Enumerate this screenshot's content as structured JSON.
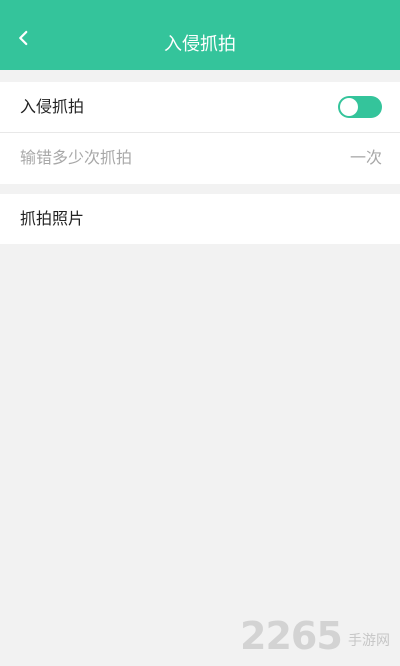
{
  "header": {
    "title": "入侵抓拍",
    "back_icon": "chevron-left-icon"
  },
  "settings": {
    "intrusion_capture": {
      "label": "入侵抓拍",
      "enabled": false
    },
    "attempts": {
      "label": "输错多少次抓拍",
      "value": "一次"
    },
    "photos": {
      "label": "抓拍照片"
    }
  },
  "watermark": {
    "number": "2265",
    "text": "手游网"
  },
  "colors": {
    "accent": "#34c49b",
    "background": "#f2f2f2",
    "text": "#222222",
    "muted": "#a8a8a8"
  }
}
